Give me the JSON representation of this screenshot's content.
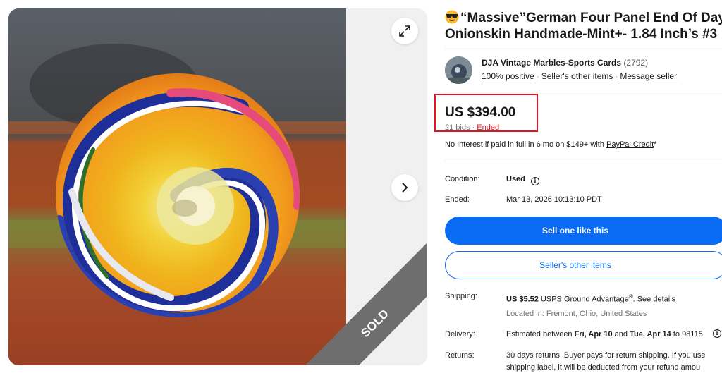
{
  "listing": {
    "title": "“Massive”German Four Panel End Of Day Onionskin Handmade-Mint+- 1.84 Inch’s #3",
    "sold_label": "SOLD"
  },
  "seller": {
    "name": "DJA Vintage Marbles-Sports Cards",
    "feedback_count": "(2792)",
    "positive": "100% positive",
    "other_items": "Seller's other items",
    "message": "Message seller"
  },
  "price": {
    "amount": "US $394.00",
    "bids": "21 bids",
    "separator": "·",
    "status": "Ended",
    "financing_prefix": "No Interest if paid in full in 6 mo on $149+ with ",
    "financing_link": "PayPal Credit",
    "financing_suffix": "*"
  },
  "details": {
    "condition_label": "Condition:",
    "condition_value": "Used",
    "ended_label": "Ended:",
    "ended_value": "Mar 13, 2026 10:13:10 PDT"
  },
  "actions": {
    "sell_one": "Sell one like this",
    "other_items": "Seller's other items"
  },
  "shipping": {
    "label": "Shipping:",
    "cost": "US $5.52",
    "service": " USPS Ground Advantage",
    "trademark": "®",
    "details_link": "See details",
    "location": "Located in: Fremont, Ohio, United States"
  },
  "delivery": {
    "label": "Delivery:",
    "prefix": "Estimated between ",
    "start": "Fri, Apr 10",
    "middle": " and ",
    "end": "Tue, Apr 14",
    "suffix": " to 98115"
  },
  "returns": {
    "label": "Returns:",
    "line1": "30 days returns. Buyer pays for return shipping. If you use",
    "line2": "shipping label, it will be deducted from your refund amou"
  },
  "colors": {
    "primary": "#0a6cf5",
    "highlight": "#e0141e",
    "ribbon": "#6e6e6e"
  }
}
